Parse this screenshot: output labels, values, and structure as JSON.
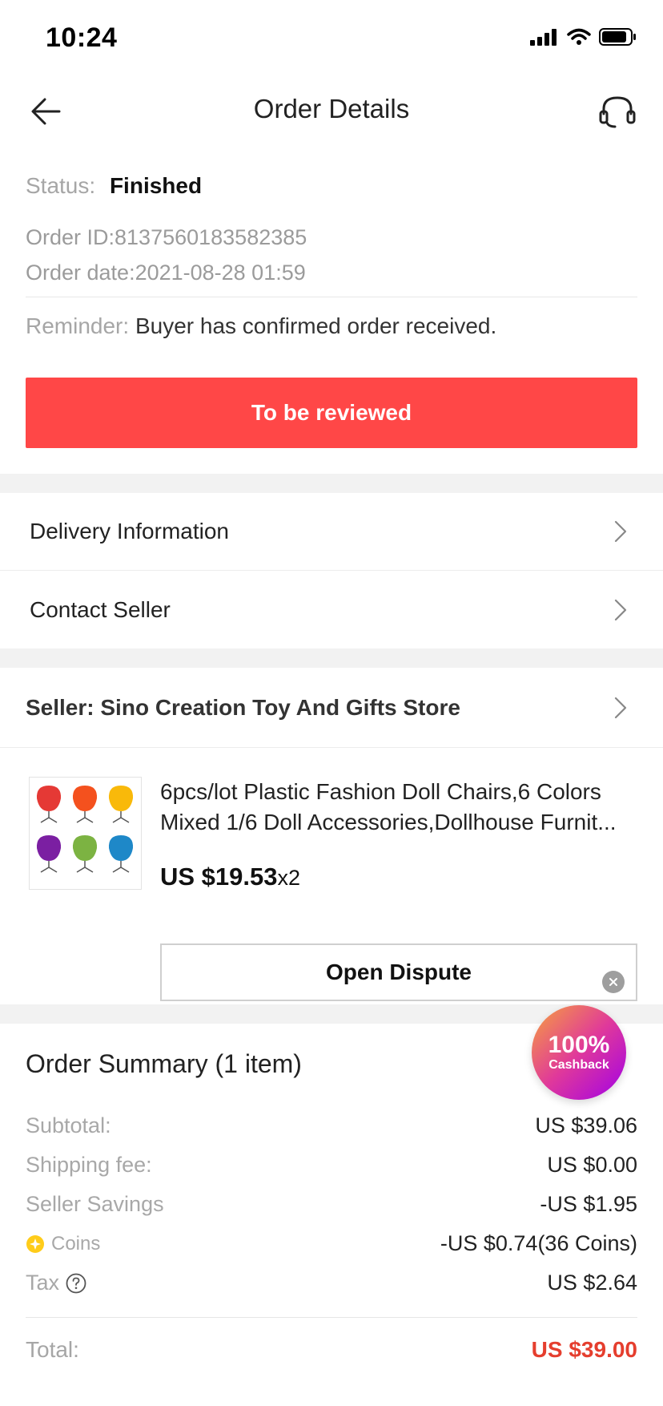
{
  "status_bar": {
    "time": "10:24"
  },
  "nav": {
    "title": "Order Details"
  },
  "status": {
    "label": "Status:",
    "value": "Finished",
    "order_id": "Order ID:8137560183582385",
    "order_date": "Order date:2021-08-28 01:59",
    "reminder_label": "Reminder:",
    "reminder_text": "Buyer has confirmed order received.",
    "review_button": "To be reviewed"
  },
  "links": {
    "delivery": "Delivery Information",
    "contact": "Contact Seller"
  },
  "seller": {
    "label": "Seller: Sino Creation Toy And Gifts Store"
  },
  "product": {
    "title_line1": "6pcs/lot Plastic Fashion Doll Chairs,6 Colors",
    "title_line2": "Mixed 1/6 Doll Accessories,Dollhouse Furnit...",
    "price": "US $19.53",
    "quantity": "x2",
    "dispute_button": "Open Dispute",
    "chair_colors": [
      "#e53935",
      "#f4511e",
      "#f9b90a",
      "#7b1fa2",
      "#7cb342",
      "#1e88c8"
    ]
  },
  "summary": {
    "title": "Order Summary (1 item)",
    "subtotal_label": "Subtotal:",
    "subtotal_value": "US $39.06",
    "shipping_label": "Shipping fee:",
    "shipping_value": "US $0.00",
    "savings_label": "Seller Savings",
    "savings_value": "-US $1.95",
    "coins_label": "Coins",
    "coins_value": "-US $0.74(36 Coins)",
    "tax_label": "Tax",
    "tax_value": "US $2.64",
    "total_label": "Total:",
    "total_value": "US $39.00"
  },
  "cashback": {
    "percent": "100%",
    "label": "Cashback"
  },
  "colors": {
    "accent_red": "#ff4747",
    "total_red": "#e53e2e",
    "coin_yellow": "#ffcc1a"
  }
}
